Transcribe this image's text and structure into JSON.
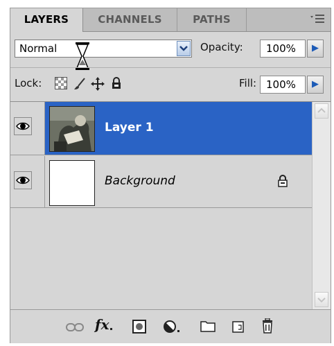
{
  "tabs": [
    {
      "label": "LAYERS",
      "active": true
    },
    {
      "label": "CHANNELS",
      "active": false
    },
    {
      "label": "PATHS",
      "active": false
    }
  ],
  "panel_menu_icon": "panel-menu-icon",
  "blend": {
    "value": "Normal",
    "cursor_icon": "hourglass-cursor"
  },
  "opacity": {
    "label": "Opacity:",
    "value": "100%"
  },
  "lock": {
    "label": "Lock:"
  },
  "fill": {
    "label": "Fill:",
    "value": "100%"
  },
  "layers": [
    {
      "name": "Layer 1",
      "selected": true,
      "visible": true,
      "locked": false
    },
    {
      "name": "Background",
      "selected": false,
      "visible": true,
      "locked": true
    }
  ],
  "bottom_icons": [
    "link-icon",
    "fx-icon",
    "mask-icon",
    "adjustment-icon",
    "group-icon",
    "new-layer-icon",
    "trash-icon"
  ],
  "bottom_fx_label": "fx",
  "colors": {
    "selection": "#2a63c5",
    "panel": "#d6d6d6",
    "tab_bar": "#bdbdbd"
  }
}
